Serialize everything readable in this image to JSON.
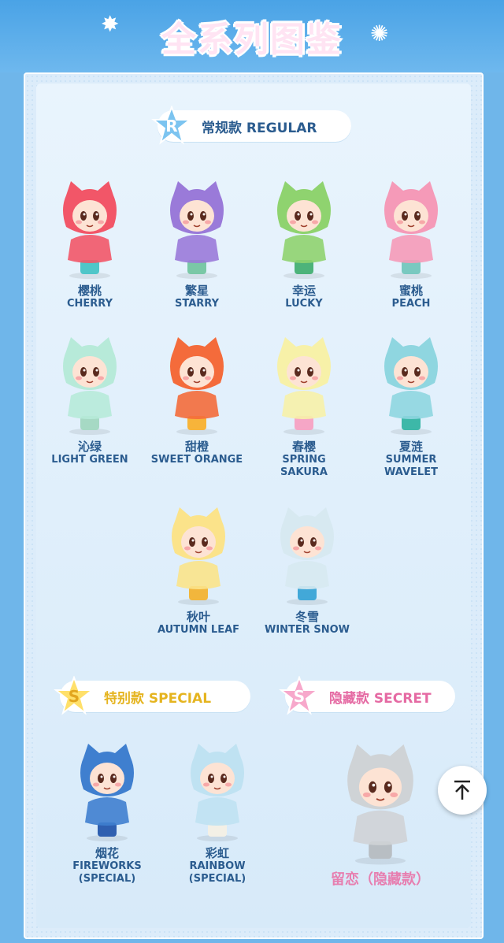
{
  "header": {
    "title": "全系列图鉴",
    "sparkle_icon": "firework-sparkle-icon"
  },
  "regular": {
    "label": "常规款 REGULAR",
    "badge": "R",
    "badge_color": "#7cc4f0",
    "items": [
      {
        "cn": "樱桃",
        "en": "CHERRY",
        "color": "#f25668",
        "accent": "#4fc6c9"
      },
      {
        "cn": "繁星",
        "en": "STARRY",
        "color": "#9a7ad9",
        "accent": "#7ac8a6"
      },
      {
        "cn": "幸运",
        "en": "LUCKY",
        "color": "#8fd36f",
        "accent": "#4db37a"
      },
      {
        "cn": "蜜桃",
        "en": "PEACH",
        "color": "#f59ab8",
        "accent": "#79c9c0"
      },
      {
        "cn": "沁绿",
        "en": "LIGHT GREEN",
        "color": "#b7ead9",
        "accent": "#a6d9c4"
      },
      {
        "cn": "甜橙",
        "en": "SWEET ORANGE",
        "color": "#f46b3b",
        "accent": "#f7b43a"
      },
      {
        "cn": "春樱",
        "en": "SPRING",
        "en2": "SAKURA",
        "color": "#f7f1a8",
        "accent": "#f6a6c6"
      },
      {
        "cn": "夏涟",
        "en": "SUMMER",
        "en2": "WAVELET",
        "color": "#8fd6e0",
        "accent": "#3db8a8"
      },
      {
        "cn": "秋叶",
        "en": "AUTUMN LEAF",
        "color": "#fbe38a",
        "accent": "#f2b63c"
      },
      {
        "cn": "冬雪",
        "en": "WINTER SNOW",
        "color": "#d7e9f1",
        "accent": "#42a8d8"
      }
    ]
  },
  "special": {
    "label": "特别款 SPECIAL",
    "badge": "S",
    "badge_color": "#ffe06a",
    "text_color": "#e8b320",
    "items": [
      {
        "cn": "烟花",
        "en": "FIREWORKS",
        "en2": "(SPECIAL)",
        "color": "#3f7fcf",
        "accent": "#2f5fb0"
      },
      {
        "cn": "彩虹",
        "en": "RAINBOW",
        "en2": "(SPECIAL)",
        "color": "#bfe2f2",
        "accent": "#f3f0e6"
      }
    ]
  },
  "secret": {
    "label": "隐藏款 SECRET",
    "badge": "S",
    "badge_color": "#f7a8cb",
    "text_color": "#e56aa3",
    "item": {
      "cn": "留恋（隐藏款）",
      "color": "#cfd3d6",
      "accent": "#b8bec3"
    }
  },
  "scroll_top": {
    "icon": "arrow-up-to-top-icon"
  }
}
